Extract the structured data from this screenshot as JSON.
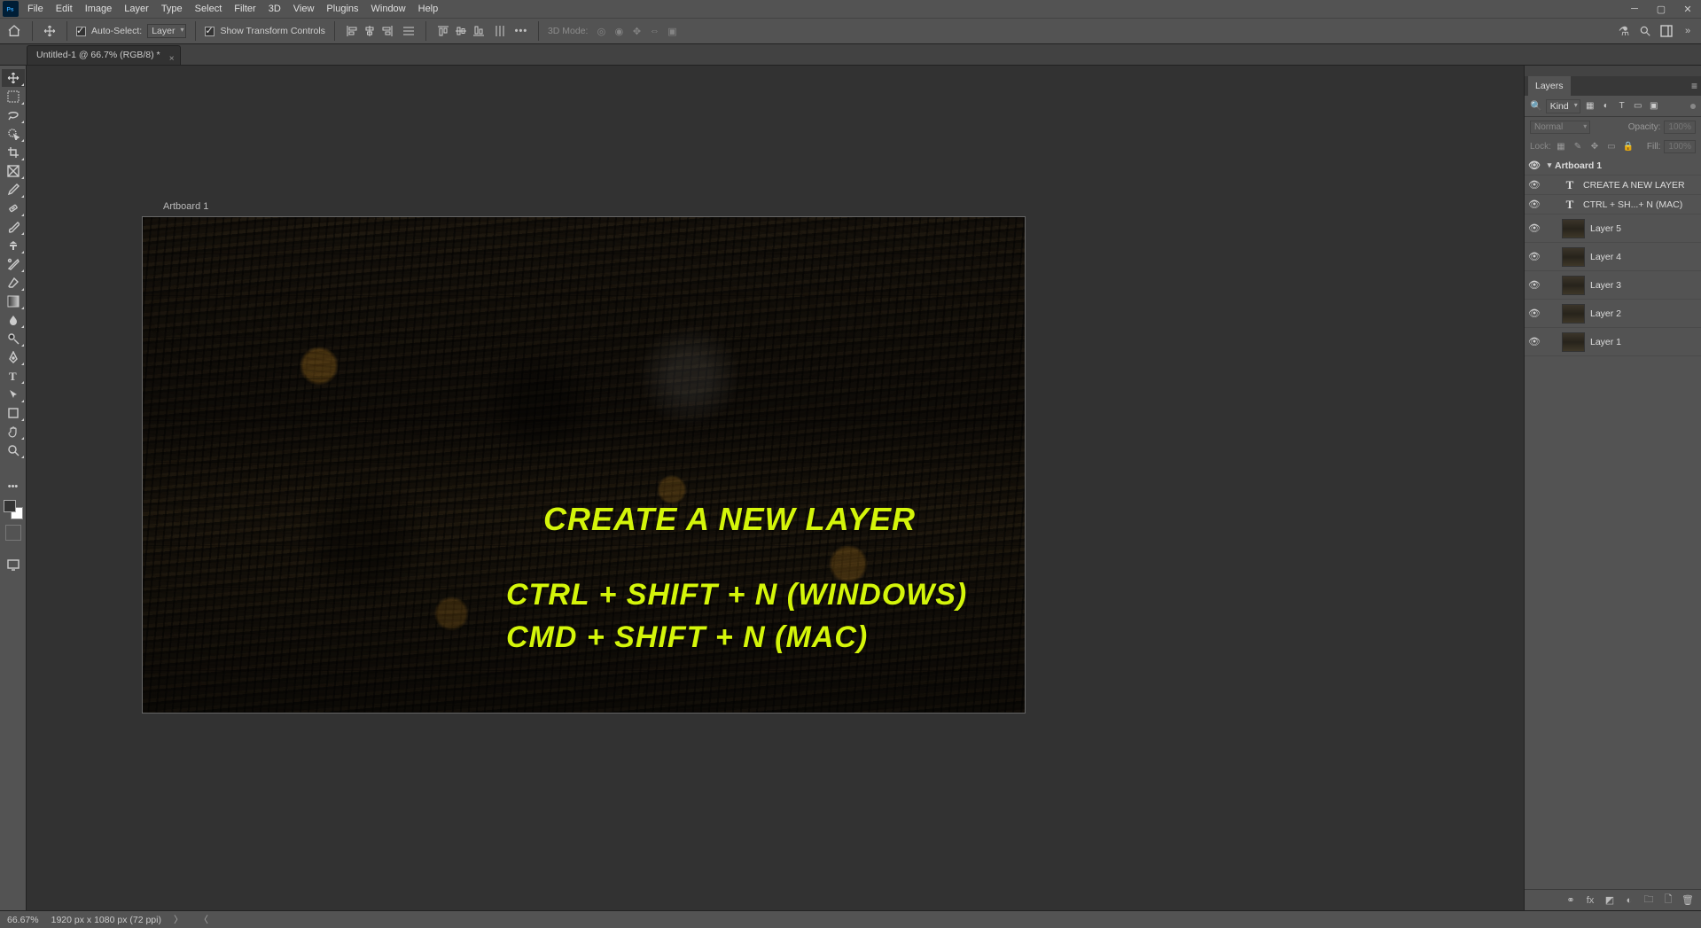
{
  "menu": {
    "items": [
      "File",
      "Edit",
      "Image",
      "Layer",
      "Type",
      "Select",
      "Filter",
      "3D",
      "View",
      "Plugins",
      "Window",
      "Help"
    ]
  },
  "options": {
    "auto_select_label": "Auto-Select:",
    "target_label": "Layer",
    "transform_label": "Show Transform Controls",
    "three_d_label": "3D Mode:"
  },
  "tab": {
    "title": "Untitled-1 @ 66.7% (RGB/8) *"
  },
  "canvas": {
    "artboard_label": "Artboard 1",
    "text_title": "CREATE A NEW LAYER",
    "text_windows": "CTRL + SHIFT + N (WINDOWS)",
    "text_mac": "CMD + SHIFT + N (MAC)"
  },
  "layers_panel": {
    "tab_label": "Layers",
    "filter_kind": "Kind",
    "blend_mode": "Normal",
    "opacity_label": "Opacity:",
    "opacity_value": "100%",
    "lock_label": "Lock:",
    "fill_label": "Fill:",
    "fill_value": "100%",
    "artboard_name": "Artboard 1",
    "rows": [
      {
        "type": "text",
        "name": "CREATE A NEW LAYER"
      },
      {
        "type": "text",
        "name": "CTRL + SH...+ N (MAC)"
      },
      {
        "type": "image",
        "name": "Layer 5"
      },
      {
        "type": "image",
        "name": "Layer 4"
      },
      {
        "type": "image",
        "name": "Layer 3"
      },
      {
        "type": "image",
        "name": "Layer 2"
      },
      {
        "type": "image",
        "name": "Layer 1"
      }
    ]
  },
  "status": {
    "zoom": "66.67%",
    "doc_info": "1920 px x 1080 px (72 ppi)"
  }
}
